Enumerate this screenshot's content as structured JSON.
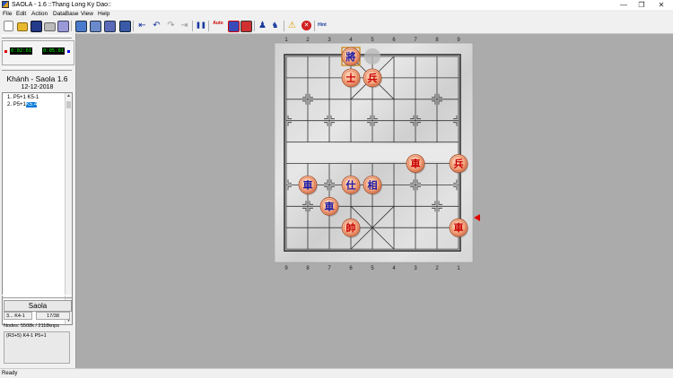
{
  "window": {
    "title": "SAOLA - 1.6 ::Thang Long Ky Dao::",
    "min_glyph": "—",
    "max_glyph": "❐",
    "close_glyph": "✕"
  },
  "menu": [
    "File",
    "Edit",
    "Action",
    "DataBase",
    "View",
    "Help"
  ],
  "toolbar": {
    "pause_glyph": "❚❚",
    "auto_label": "Auto",
    "hint_label": "Hint"
  },
  "clocks": {
    "red_time": "0:02:01",
    "black_time": "0:05:01",
    "red_color": "#e00000",
    "black_color": "#0000e0"
  },
  "game": {
    "title": "Khánh - Saola 1.6",
    "date": "12-12-2018",
    "moves": [
      {
        "num": "1.",
        "red": "P5+1",
        "black": "K5-1"
      },
      {
        "num": "2.",
        "red": "P5+1",
        "black": "K5.4"
      }
    ]
  },
  "engine": {
    "name": "Saola",
    "move_no": "3...",
    "current_move": "K4-1",
    "progress": "17/38",
    "nodes": "Nodes: 5508k / 2118knps",
    "pv": "(R3+5) K4-1 P5+1"
  },
  "board": {
    "top_coords": [
      "1",
      "2",
      "3",
      "4",
      "5",
      "6",
      "7",
      "8",
      "9"
    ],
    "bottom_coords": [
      "9",
      "8",
      "7",
      "6",
      "5",
      "4",
      "3",
      "2",
      "1"
    ],
    "side_to_move_color": "#e00000",
    "pieces": [
      {
        "char": "將",
        "side": "black",
        "name": "black-general",
        "file": 3,
        "rank": 0
      },
      {
        "char": "士",
        "side": "red",
        "name": "red-advisor-top",
        "file": 3,
        "rank": 1
      },
      {
        "char": "兵",
        "side": "red",
        "name": "red-pawn-center",
        "file": 4,
        "rank": 1
      },
      {
        "char": "車",
        "side": "red",
        "name": "red-chariot-river",
        "file": 6,
        "rank": 5
      },
      {
        "char": "兵",
        "side": "red",
        "name": "red-pawn-right",
        "file": 8,
        "rank": 5
      },
      {
        "char": "車",
        "side": "black",
        "name": "black-chariot-left",
        "file": 1,
        "rank": 6
      },
      {
        "char": "仕",
        "side": "black",
        "name": "black-advisor",
        "file": 3,
        "rank": 6
      },
      {
        "char": "相",
        "side": "black",
        "name": "black-elephant",
        "file": 4,
        "rank": 6
      },
      {
        "char": "車",
        "side": "black",
        "name": "black-chariot-low",
        "file": 2,
        "rank": 7
      },
      {
        "char": "帥",
        "side": "red",
        "name": "red-general",
        "file": 3,
        "rank": 8
      },
      {
        "char": "車",
        "side": "red",
        "name": "red-chariot-corner",
        "file": 8,
        "rank": 8
      }
    ]
  }
}
